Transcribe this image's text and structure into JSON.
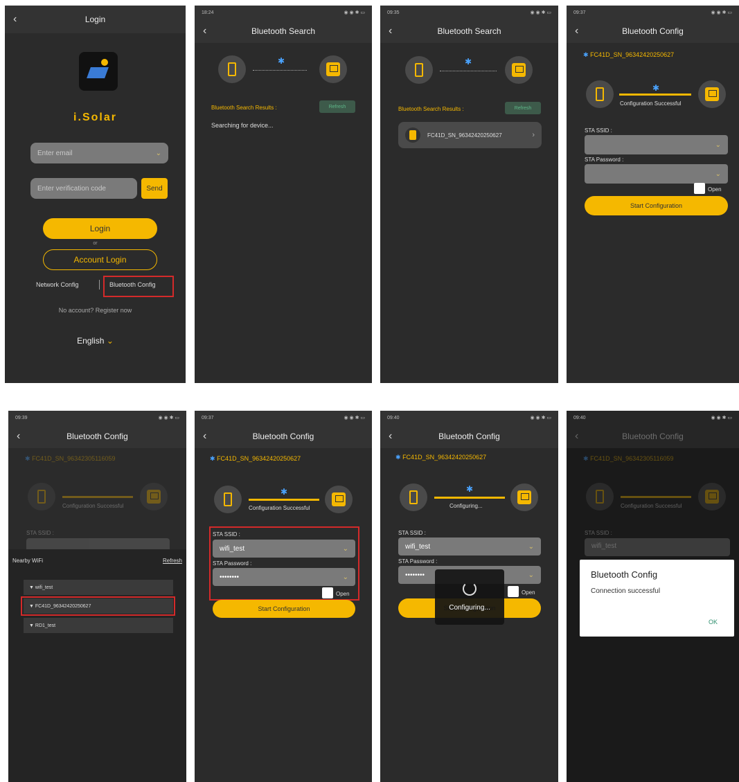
{
  "s1": {
    "title": "Login",
    "app_name": "i.Solar",
    "email_placeholder": "Enter email",
    "code_placeholder": "Enter verification code",
    "send": "Send",
    "login": "Login",
    "or": "or",
    "account_login": "Account Login",
    "network_config": "Network Config",
    "bluetooth_config": "Bluetooth Config",
    "register": "No account? Register now",
    "language": "English"
  },
  "s2": {
    "time": "18:24",
    "title": "Bluetooth Search",
    "results": "Bluetooth Search Results :",
    "refresh": "Refresh",
    "searching": "Searching for device..."
  },
  "s3": {
    "time": "09:35",
    "title": "Bluetooth Search",
    "results": "Bluetooth Search Results :",
    "refresh": "Refresh",
    "device": "FC41D_SN_96342420250627"
  },
  "s4": {
    "time": "09:37",
    "title": "Bluetooth Config",
    "device": "FC41D_SN_96342420250627",
    "status": "Configuration Successful",
    "ssid_label": "STA SSID :",
    "pwd_label": "STA Password :",
    "open": "Open",
    "start": "Start Configuration"
  },
  "s5": {
    "time": "09:39",
    "title": "Bluetooth Config",
    "device": "FC41D_SN_96342305116059",
    "status": "Configuration Successful",
    "ssid_label": "STA SSID :",
    "nearby": "Nearby WiFi",
    "refresh": "Refresh",
    "wifi": [
      "wifi_test",
      "FC41D_96342420250627",
      "RD1_test"
    ]
  },
  "s6": {
    "time": "09:37",
    "title": "Bluetooth Config",
    "device": "FC41D_SN_96342420250627",
    "status": "Configuration Successful",
    "ssid_label": "STA SSID :",
    "ssid_value": "wifi_test",
    "pwd_label": "STA Password :",
    "pwd_value": "••••••••",
    "open": "Open",
    "start": "Start Configuration"
  },
  "s7": {
    "time": "09:40",
    "title": "Bluetooth Config",
    "device": "FC41D_SN_96342420250627",
    "status": "Configuring...",
    "ssid_label": "STA SSID :",
    "ssid_value": "wifi_test",
    "pwd_label": "STA Password :",
    "pwd_value": "••••••••",
    "open": "Open",
    "start": "Start Configuration",
    "overlay": "Configuring..."
  },
  "s8": {
    "time": "09:40",
    "title": "Bluetooth Config",
    "device": "FC41D_SN_96342305116059",
    "status": "Configuration Successful",
    "ssid_label": "STA SSID :",
    "ssid_value": "wifi_test",
    "dialog_title": "Bluetooth Config",
    "dialog_msg": "Connection successful",
    "ok": "OK"
  },
  "colors": {
    "accent": "#f5b800",
    "screen": "#2b2b2b",
    "highlight": "#d42a2a"
  }
}
